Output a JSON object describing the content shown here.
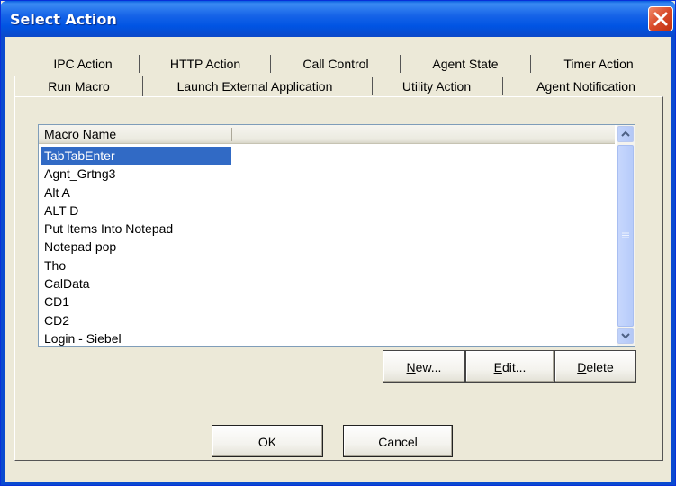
{
  "window": {
    "title": "Select Action"
  },
  "tabs": {
    "row1": [
      "IPC Action",
      "HTTP Action",
      "Call Control",
      "Agent State",
      "Timer Action"
    ],
    "row2": [
      "Run Macro",
      "Launch External Application",
      "Utility Action",
      "Agent Notification"
    ],
    "active": "Run Macro"
  },
  "list": {
    "column_header": "Macro Name",
    "items": [
      "TabTabEnter",
      "Agnt_Grtng3",
      "Alt A",
      "ALT D",
      "Put Items Into Notepad",
      "Notepad pop",
      "Tho",
      "CalData",
      "CD1",
      "CD2",
      "Login - Siebel"
    ],
    "selected_index": 0
  },
  "buttons": {
    "new_label_mnemonic": "N",
    "new_label_rest": "ew...",
    "edit_label_mnemonic": "E",
    "edit_label_rest": "dit...",
    "delete_label_mnemonic": "D",
    "delete_label_rest": "elete",
    "ok_label": "OK",
    "cancel_label": "Cancel"
  },
  "colors": {
    "title_bar": "#0054e3",
    "selection": "#316ac5",
    "close_button": "#d84a2a"
  }
}
